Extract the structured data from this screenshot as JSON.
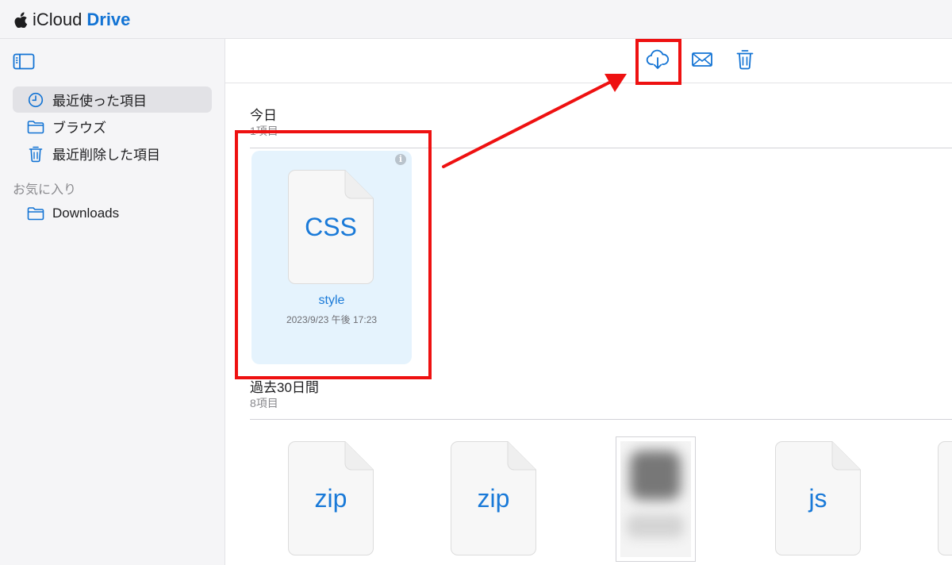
{
  "brand": {
    "icloud": "iCloud",
    "drive": "Drive"
  },
  "sidebar": {
    "items": [
      {
        "label": "最近使った項目",
        "icon": "clock-icon"
      },
      {
        "label": "ブラウズ",
        "icon": "folder-icon"
      },
      {
        "label": "最近削除した項目",
        "icon": "trash-icon"
      }
    ],
    "favorites_heading": "お気に入り",
    "favorites": [
      {
        "label": "Downloads",
        "icon": "folder-icon"
      }
    ]
  },
  "toolbar": {
    "buttons": [
      {
        "icon": "cloud-download-icon"
      },
      {
        "icon": "mail-icon"
      },
      {
        "icon": "trash-icon"
      }
    ]
  },
  "sections": [
    {
      "title": "今日",
      "count": "1項目",
      "files": [
        {
          "ext": "CSS",
          "name": "style",
          "date": "2023/9/23 午後 17:23",
          "selected": true
        }
      ]
    },
    {
      "title": "過去30日間",
      "count": "8項目",
      "files": [
        {
          "ext": "zip"
        },
        {
          "ext": "zip"
        },
        {
          "ext": ""
        },
        {
          "ext": "js"
        }
      ]
    }
  ],
  "colors": {
    "accent": "#1273d4",
    "annotation": "#ee1111",
    "selected_bg": "#e5f3fd"
  }
}
